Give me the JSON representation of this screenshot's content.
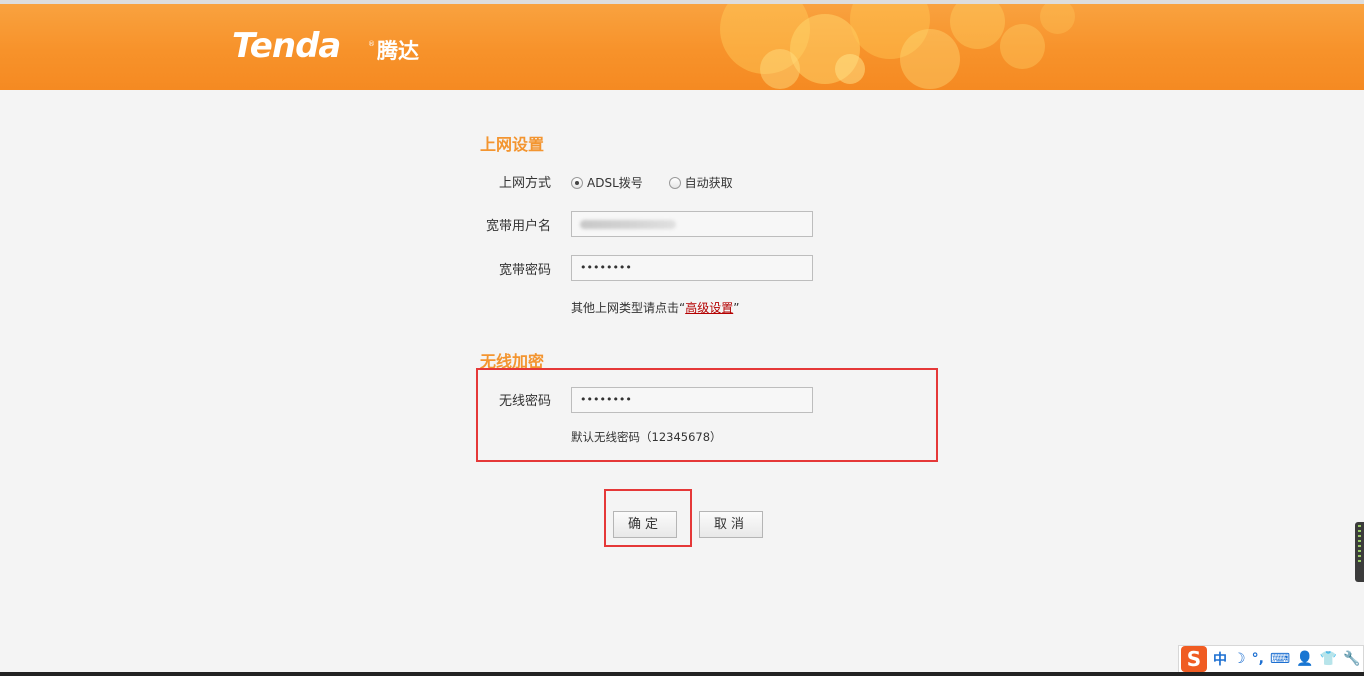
{
  "header": {
    "logo_text": "Tenda",
    "logo_reg": "®",
    "logo_cn": "腾达"
  },
  "internet": {
    "section_title": "上网设置",
    "mode_label": "上网方式",
    "mode_options": [
      {
        "label": "ADSL拨号",
        "checked": true
      },
      {
        "label": "自动获取",
        "checked": false
      }
    ],
    "username_label": "宽带用户名",
    "password_label": "宽带密码",
    "password_value": "••••••••",
    "hint_prefix": "其他上网类型请点击“",
    "hint_link": "高级设置",
    "hint_suffix": "”"
  },
  "wireless": {
    "section_title": "无线加密",
    "password_label": "无线密码",
    "password_value": "••••••••",
    "default_hint": "默认无线密码（12345678）"
  },
  "buttons": {
    "confirm": "确定",
    "cancel": "取消"
  },
  "ime": {
    "logo": "S",
    "items": [
      "中",
      "☽",
      "°,",
      "⌨",
      "👤",
      "👕",
      "🔧"
    ]
  },
  "colors": {
    "header": "#f7922a",
    "section_title": "#f39530",
    "highlight_box": "#e53838",
    "link": "#b40000"
  }
}
